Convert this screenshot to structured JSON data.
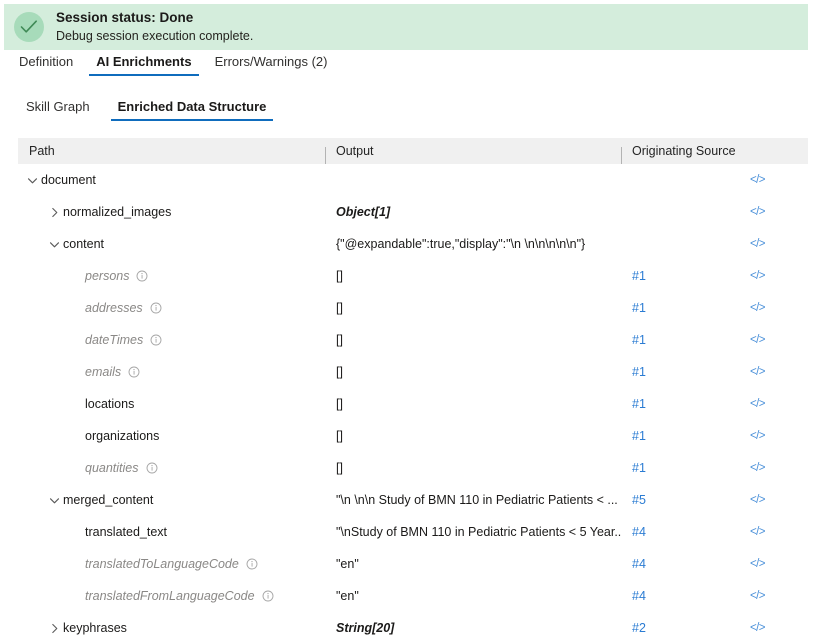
{
  "banner": {
    "icon": "check-circle-icon",
    "title": "Session status: Done",
    "subtitle": "Debug session execution complete.",
    "bg_color": "#d4eddc",
    "icon_bg_color": "#a7dbba",
    "check_color": "#3f8a56"
  },
  "primary_tabs": [
    {
      "label": "Definition",
      "active": false
    },
    {
      "label": "AI Enrichments",
      "active": true
    },
    {
      "label": "Errors/Warnings (2)",
      "active": false
    }
  ],
  "secondary_tabs": [
    {
      "label": "Skill Graph",
      "active": false
    },
    {
      "label": "Enriched Data Structure",
      "active": true
    }
  ],
  "accent_color": "#0f6cbd",
  "link_color": "#2b7cd3",
  "table": {
    "columns": [
      {
        "label": "Path",
        "key": "path"
      },
      {
        "label": "Output",
        "key": "output"
      },
      {
        "label": "Originating Source",
        "key": "source"
      }
    ],
    "code_icon": "code-icon",
    "code_icon_glyph": "</>",
    "info_icon": "info-icon",
    "rows": [
      {
        "indent": 0,
        "chevron": "down",
        "label": "document",
        "dim": false,
        "output": "",
        "typed": false,
        "source": ""
      },
      {
        "indent": 1,
        "chevron": "right",
        "label": "normalized_images",
        "dim": false,
        "output": "Object[1]",
        "typed": true,
        "source": ""
      },
      {
        "indent": 1,
        "chevron": "down",
        "label": "content",
        "dim": false,
        "output": "{\"@expandable\":true,\"display\":\"\\n \\n\\n\\n\\n\\n\"}",
        "typed": false,
        "source": ""
      },
      {
        "indent": 2,
        "chevron": "none",
        "label": "persons",
        "dim": true,
        "info": true,
        "output": "[]",
        "typed": false,
        "source": "#1"
      },
      {
        "indent": 2,
        "chevron": "none",
        "label": "addresses",
        "dim": true,
        "info": true,
        "output": "[]",
        "typed": false,
        "source": "#1"
      },
      {
        "indent": 2,
        "chevron": "none",
        "label": "dateTimes",
        "dim": true,
        "info": true,
        "output": "[]",
        "typed": false,
        "source": "#1"
      },
      {
        "indent": 2,
        "chevron": "none",
        "label": "emails",
        "dim": true,
        "info": true,
        "output": "[]",
        "typed": false,
        "source": "#1"
      },
      {
        "indent": 2,
        "chevron": "none",
        "label": "locations",
        "dim": false,
        "info": false,
        "output": "[]",
        "typed": false,
        "source": "#1"
      },
      {
        "indent": 2,
        "chevron": "none",
        "label": "organizations",
        "dim": false,
        "info": false,
        "output": "[]",
        "typed": false,
        "source": "#1"
      },
      {
        "indent": 2,
        "chevron": "none",
        "label": "quantities",
        "dim": true,
        "info": true,
        "output": "[]",
        "typed": false,
        "source": "#1"
      },
      {
        "indent": 1,
        "chevron": "down",
        "label": "merged_content",
        "dim": false,
        "output": "\"\\n \\n\\n Study of BMN 110 in Pediatric Patients < ...",
        "typed": false,
        "source": "#5"
      },
      {
        "indent": 2,
        "chevron": "none",
        "label": "translated_text",
        "dim": false,
        "output": "\"\\nStudy of BMN 110 in Pediatric Patients < 5 Year...",
        "typed": false,
        "source": "#4"
      },
      {
        "indent": 2,
        "chevron": "none",
        "label": "translatedToLanguageCode",
        "dim": true,
        "info": true,
        "output": "\"en\"",
        "typed": false,
        "source": "#4"
      },
      {
        "indent": 2,
        "chevron": "none",
        "label": "translatedFromLanguageCode",
        "dim": true,
        "info": true,
        "output": "\"en\"",
        "typed": false,
        "source": "#4"
      },
      {
        "indent": 1,
        "chevron": "right",
        "label": "keyphrases",
        "dim": false,
        "output": "String[20]",
        "typed": true,
        "source": "#2"
      }
    ]
  }
}
